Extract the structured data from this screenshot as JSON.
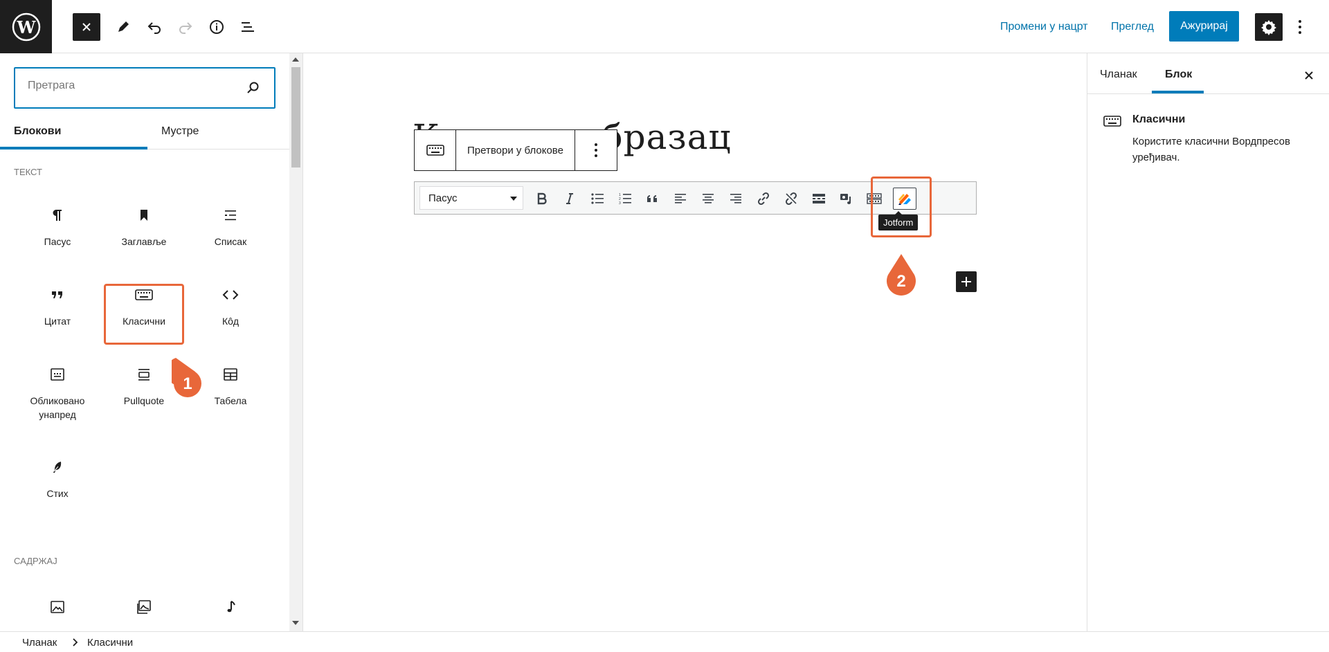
{
  "colors": {
    "accent": "#007cba",
    "annotation": "#e8673a",
    "dark": "#1e1e1e"
  },
  "topbar": {
    "logo_icon": "wordpress-logo-icon",
    "switch_draft": "Промени у нацрт",
    "preview": "Преглед",
    "update": "Ажурирај"
  },
  "inserter": {
    "search_placeholder": "Претрага",
    "tabs": [
      "Блокови",
      "Мустре"
    ],
    "categories": {
      "text": "Текст",
      "media": "Садржај"
    },
    "blocks": [
      {
        "label": "Пасус",
        "icon": "paragraph-icon"
      },
      {
        "label": "Заглавље",
        "icon": "bookmark-icon"
      },
      {
        "label": "Списак",
        "icon": "list-icon"
      },
      {
        "label": "Цитат",
        "icon": "quote-icon"
      },
      {
        "label": "Класични",
        "icon": "keyboard-icon"
      },
      {
        "label": "Кôд",
        "icon": "code-icon"
      },
      {
        "label": "Обликовано унапред",
        "icon": "preformatted-icon"
      },
      {
        "label": "Pullquote",
        "icon": "pullquote-icon"
      },
      {
        "label": "Табела",
        "icon": "table-icon"
      },
      {
        "label": "Стих",
        "icon": "feather-icon"
      }
    ],
    "annotation_1": "1"
  },
  "editor": {
    "title": "Контакт образац",
    "convert_label": "Претвори у блокове",
    "format_select": "Пасус",
    "tooltip": "Jotform",
    "annotation_2": "2"
  },
  "sidebar": {
    "tabs": [
      "Чланак",
      "Блок"
    ],
    "block_name": "Класични",
    "block_desc": "Користите класични Вордпресов уређивач."
  },
  "breadcrumb": [
    "Чланак",
    "Класични"
  ]
}
